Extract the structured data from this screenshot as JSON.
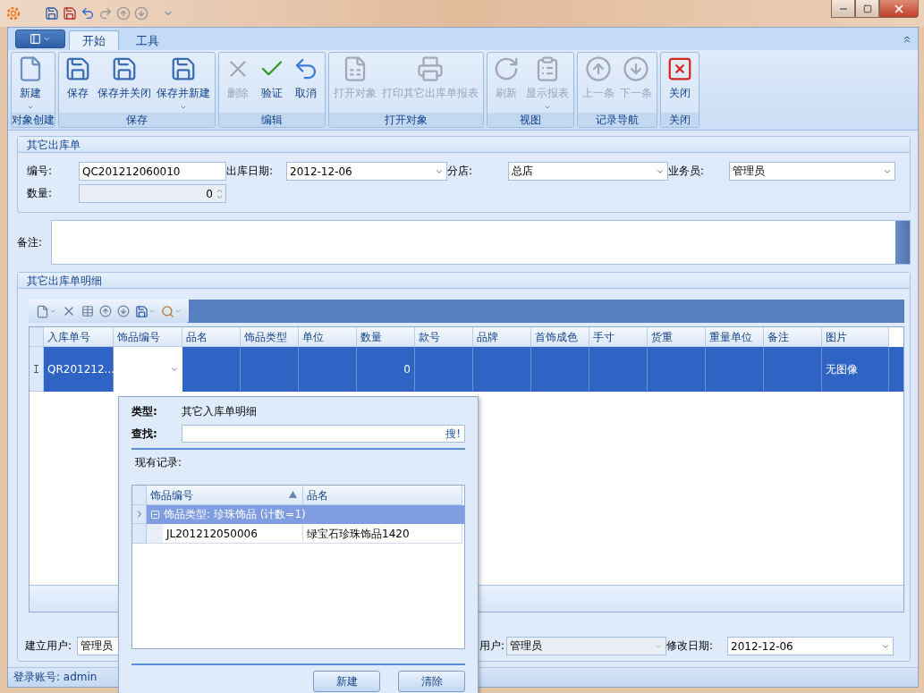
{
  "ribbon": {
    "tabs": [
      {
        "label": "开始",
        "selected": true
      },
      {
        "label": "工具",
        "selected": false
      }
    ],
    "groups": [
      {
        "caption": "对象创建",
        "buttons": [
          {
            "label": "新建",
            "disabled": false,
            "dropdown": true
          }
        ]
      },
      {
        "caption": "保存",
        "buttons": [
          {
            "label": "保存",
            "disabled": false,
            "dropdown": false
          },
          {
            "label": "保存并关闭",
            "disabled": false,
            "dropdown": false
          },
          {
            "label": "保存并新建",
            "disabled": false,
            "dropdown": true
          }
        ]
      },
      {
        "caption": "编辑",
        "buttons": [
          {
            "label": "删除",
            "disabled": true,
            "dropdown": false
          },
          {
            "label": "验证",
            "disabled": false,
            "dropdown": false
          },
          {
            "label": "取消",
            "disabled": false,
            "dropdown": false
          }
        ]
      },
      {
        "caption": "打开对象",
        "buttons": [
          {
            "label": "打开对象",
            "disabled": true,
            "dropdown": false
          },
          {
            "label": "打印其它出库单报表",
            "disabled": true,
            "dropdown": false
          }
        ]
      },
      {
        "caption": "视图",
        "buttons": [
          {
            "label": "刷新",
            "disabled": true,
            "dropdown": false
          },
          {
            "label": "显示报表",
            "disabled": true,
            "dropdown": true
          }
        ]
      },
      {
        "caption": "记录导航",
        "buttons": [
          {
            "label": "上一条",
            "disabled": true,
            "dropdown": false
          },
          {
            "label": "下一条",
            "disabled": true,
            "dropdown": false
          }
        ]
      },
      {
        "caption": "关闭",
        "buttons": [
          {
            "label": "关闭",
            "disabled": false,
            "dropdown": false
          }
        ]
      }
    ]
  },
  "header_group": {
    "title": "其它出库单",
    "fields": [
      {
        "label": "编号:",
        "value": "QC201212060010",
        "kind": "text",
        "disabled": false
      },
      {
        "label": "出库日期:",
        "value": "2012-12-06",
        "kind": "combo",
        "disabled": false
      },
      {
        "label": "分店:",
        "value": "总店",
        "kind": "combo",
        "disabled": false
      },
      {
        "label": "业务员:",
        "value": "管理员",
        "kind": "combo",
        "disabled": false
      },
      {
        "label": "数量:",
        "value": "0",
        "kind": "spin",
        "disabled": true
      }
    ]
  },
  "notes": {
    "label": "备注:"
  },
  "detail_group": {
    "title": "其它出库单明细",
    "columns": [
      "入库单号",
      "饰品编号",
      "品名",
      "饰品类型",
      "单位",
      "数量",
      "款号",
      "品牌",
      "首饰成色",
      "手寸",
      "货重",
      "重量单位",
      "备注",
      "图片"
    ],
    "rows": [
      {
        "selected": true,
        "cells": [
          "QR201212...",
          null,
          null,
          null,
          null,
          "0",
          null,
          null,
          null,
          null,
          null,
          null,
          null,
          "无图像"
        ]
      }
    ]
  },
  "footer_fields": [
    {
      "label": "建立用户:",
      "value": "管理员",
      "kind": "text",
      "disabled": false
    },
    {
      "label": "用户:",
      "value": "管理员",
      "kind": "combo",
      "disabled": true
    },
    {
      "label": "修改日期:",
      "value": "2012-12-06",
      "kind": "combo",
      "disabled": false
    }
  ],
  "status_bar": {
    "text": "登录账号: admin"
  },
  "lookup_popup": {
    "type_label": "类型:",
    "type_value": "其它入库单明细",
    "search_label": "查找:",
    "search_button": "搜!",
    "records_label": "现有记录:",
    "columns": [
      {
        "label": "饰品编号",
        "sorted": true
      },
      {
        "label": "品名",
        "sorted": false
      }
    ],
    "group": {
      "label": "饰品类型: 珍珠饰品 (计数=1)",
      "expanded": true,
      "rows": [
        [
          "JL201212050006",
          "绿宝石珍珠饰品1420"
        ]
      ]
    },
    "buttons": [
      "新建",
      "清除"
    ]
  }
}
